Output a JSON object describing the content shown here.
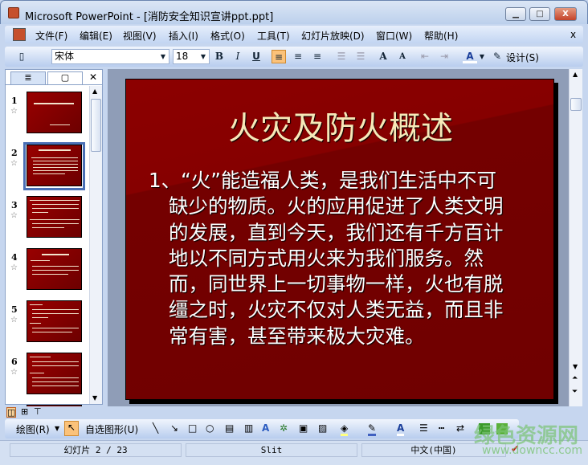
{
  "window": {
    "title": "Microsoft PowerPoint - [消防安全知识宣讲ppt.ppt]",
    "min": "▁",
    "max": "□",
    "close": "X"
  },
  "menu": [
    "文件(F)",
    "编辑(E)",
    "视图(V)",
    "插入(I)",
    "格式(O)",
    "工具(T)",
    "幻灯片放映(D)",
    "窗口(W)",
    "帮助(H)"
  ],
  "menu_close": "x",
  "toolbar": {
    "font": "宋体",
    "size": "18",
    "bold": "B",
    "italic": "I",
    "underline": "U",
    "design": "设计(S)",
    "font_color": "A"
  },
  "panel": {
    "close": "✕"
  },
  "slides": [
    {
      "n": "1"
    },
    {
      "n": "2"
    },
    {
      "n": "3"
    },
    {
      "n": "4"
    },
    {
      "n": "5"
    },
    {
      "n": "6"
    }
  ],
  "slide": {
    "title": "火灾及防火概述",
    "lines": [
      "1、“火”能造福人类，是我们生活中不可",
      "缺少的物质。火的应用促进了人类文明",
      "的发展，直到今天，我们还有千方百计",
      "地以不同方式用火来为我们服务。然",
      "而，同世界上一切事物一样，火也有脱",
      "缰之时，火灾不仅对人类无益，而且非",
      "常有害，甚至带来极大灾难。"
    ]
  },
  "drawbar": {
    "draw": "绘图(R)",
    "autoshapes": "自选图形(U)"
  },
  "status": {
    "slide": "幻灯片 2 / 23",
    "design": "Slit",
    "lang": "中文(中国)"
  },
  "watermark": {
    "text": "绿色资源网",
    "url": "www.downcc.com"
  },
  "colors": {
    "slide_bg": "#7a0000",
    "title": "#f6e8b8",
    "accent": "#4a6fb5"
  }
}
